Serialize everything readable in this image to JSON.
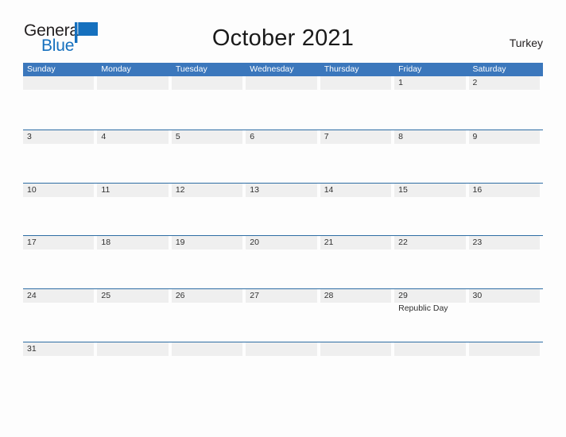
{
  "brand": {
    "word_one": "General",
    "word_two": "Blue",
    "flag_icon": "blue-triangle-flag-icon",
    "color_dark": "#231f20",
    "color_blue": "#1570be"
  },
  "header": {
    "title": "October 2021",
    "country": "Turkey"
  },
  "colors": {
    "header_blue": "#3b77bc",
    "rule_blue": "#2e6da4",
    "band_gray": "#efefef",
    "page_bg": "#fdfdfd",
    "text": "#303030"
  },
  "calendar": {
    "month": "October",
    "year": "2021",
    "weekday_headers": [
      "Sunday",
      "Monday",
      "Tuesday",
      "Wednesday",
      "Thursday",
      "Friday",
      "Saturday"
    ],
    "weeks": [
      [
        {
          "day": ""
        },
        {
          "day": ""
        },
        {
          "day": ""
        },
        {
          "day": ""
        },
        {
          "day": ""
        },
        {
          "day": "1"
        },
        {
          "day": "2"
        }
      ],
      [
        {
          "day": "3"
        },
        {
          "day": "4"
        },
        {
          "day": "5"
        },
        {
          "day": "6"
        },
        {
          "day": "7"
        },
        {
          "day": "8"
        },
        {
          "day": "9"
        }
      ],
      [
        {
          "day": "10"
        },
        {
          "day": "11"
        },
        {
          "day": "12"
        },
        {
          "day": "13"
        },
        {
          "day": "14"
        },
        {
          "day": "15"
        },
        {
          "day": "16"
        }
      ],
      [
        {
          "day": "17"
        },
        {
          "day": "18"
        },
        {
          "day": "19"
        },
        {
          "day": "20"
        },
        {
          "day": "21"
        },
        {
          "day": "22"
        },
        {
          "day": "23"
        }
      ],
      [
        {
          "day": "24"
        },
        {
          "day": "25"
        },
        {
          "day": "26"
        },
        {
          "day": "27"
        },
        {
          "day": "28"
        },
        {
          "day": "29",
          "event": "Republic Day"
        },
        {
          "day": "30"
        }
      ],
      [
        {
          "day": "31"
        },
        {
          "day": ""
        },
        {
          "day": ""
        },
        {
          "day": ""
        },
        {
          "day": ""
        },
        {
          "day": ""
        },
        {
          "day": ""
        }
      ]
    ]
  }
}
